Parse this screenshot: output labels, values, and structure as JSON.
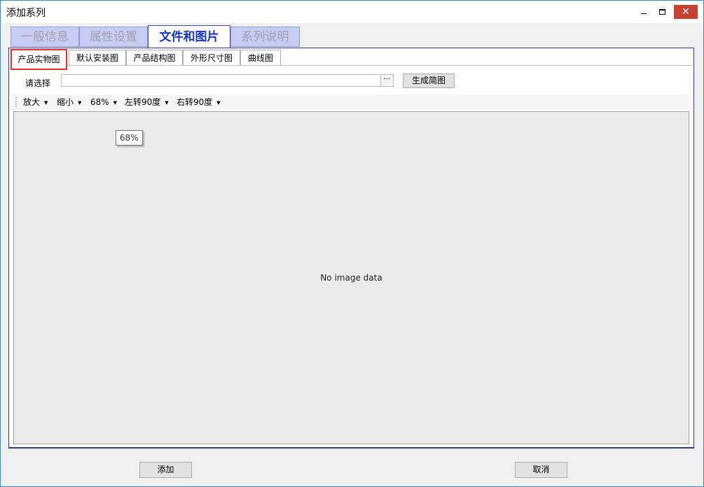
{
  "window": {
    "title": "添加系列"
  },
  "main_tabs": [
    {
      "label": "一般信息"
    },
    {
      "label": "属性设置"
    },
    {
      "label": "文件和图片"
    },
    {
      "label": "系列说明"
    }
  ],
  "sub_tabs": [
    {
      "label": "产品实物图"
    },
    {
      "label": "默认安装图"
    },
    {
      "label": "产品结构图"
    },
    {
      "label": "外形尺寸图"
    },
    {
      "label": "曲线图"
    }
  ],
  "file": {
    "label": "请选择",
    "value": "",
    "browse_label": "···",
    "generate_label": "生成简图"
  },
  "toolbar": {
    "zoom_in": "放大",
    "zoom_out": "缩小",
    "zoom_level": "68%",
    "rotate_left": "左转90度",
    "rotate_right": "右转90度"
  },
  "viewer": {
    "empty_text": "No image data",
    "tooltip": "68%"
  },
  "footer": {
    "add_label": "添加",
    "cancel_label": "取消"
  },
  "colors": {
    "active_tab_text": "#1833c8",
    "inactive_tab_bg": "#c6ccf3",
    "close_button": "#c84031",
    "selected_subtab_border": "#e03030"
  }
}
